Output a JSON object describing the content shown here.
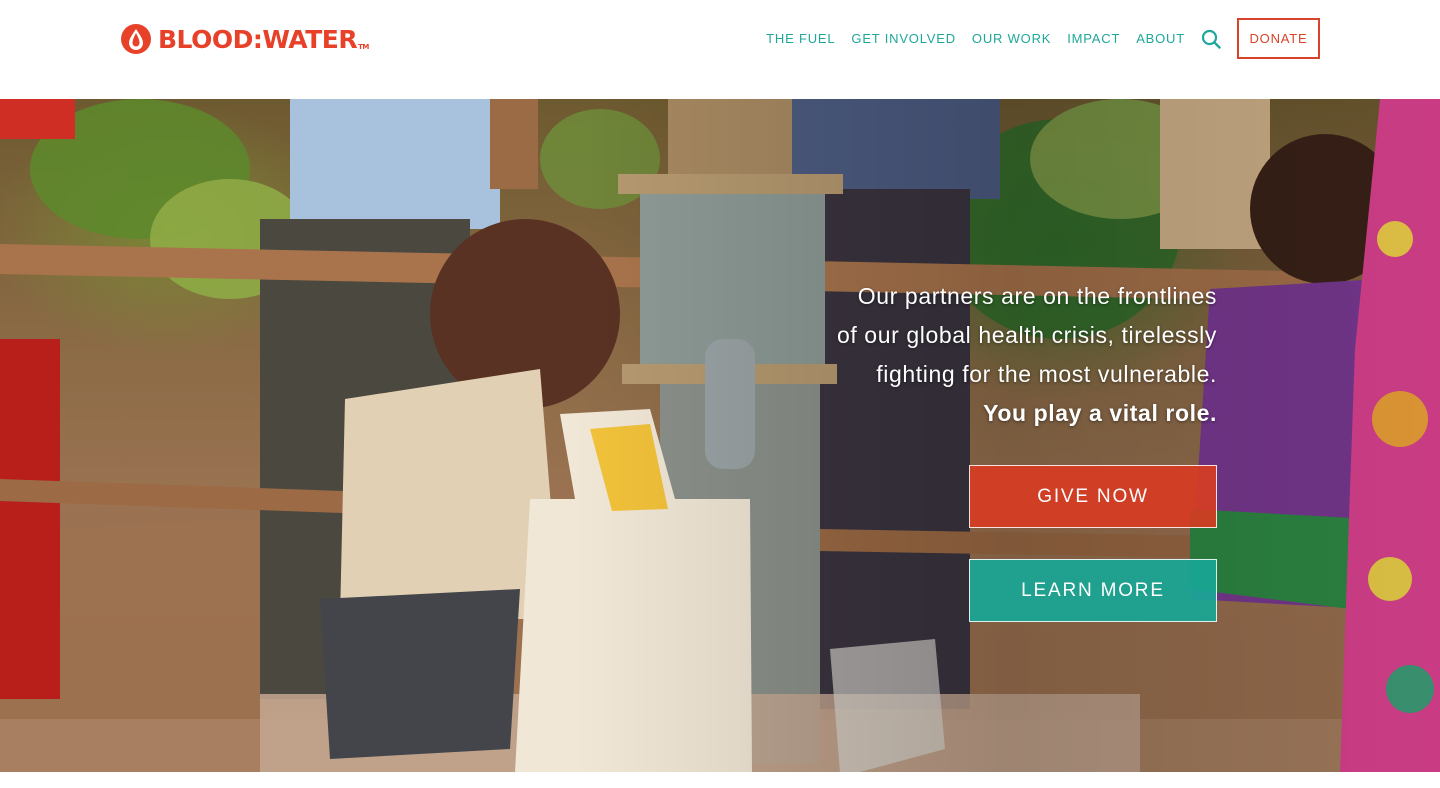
{
  "brand": {
    "logo_text": "BLOOD:WATER",
    "logo_tm": "TM",
    "accent_red": "#e8412a",
    "accent_teal": "#1fa79a"
  },
  "nav": {
    "items": [
      {
        "label": "THE FUEL"
      },
      {
        "label": "GET INVOLVED"
      },
      {
        "label": "OUR WORK"
      },
      {
        "label": "IMPACT"
      },
      {
        "label": "ABOUT"
      }
    ],
    "search_icon": "search-icon",
    "donate_label": "DONATE"
  },
  "hero": {
    "lines": [
      "Our partners are on the frontlines",
      "of our global health crisis, tirelessly",
      "fighting for the most vulnerable."
    ],
    "emphasis": "You play a vital role.",
    "give_label": "GIVE NOW",
    "learn_label": "LEARN MORE"
  }
}
